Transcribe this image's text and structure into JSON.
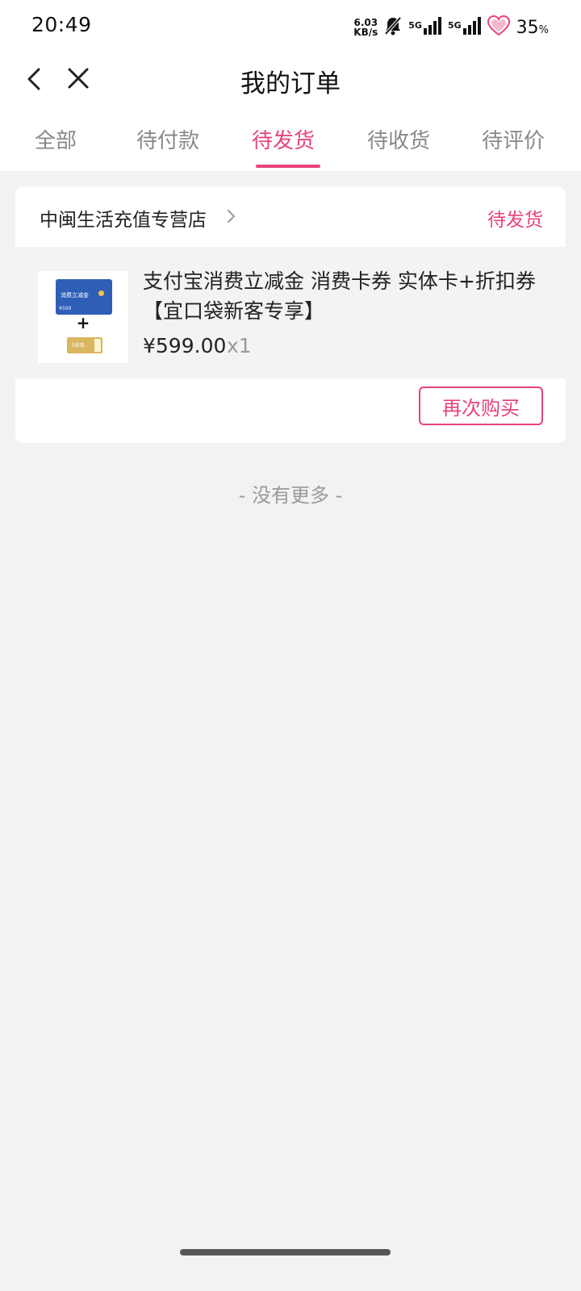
{
  "status_bar": {
    "time": "20:49",
    "net_speed_value": "6.03",
    "net_speed_unit": "KB/s",
    "signal1_label": "5G",
    "signal2_label": "5G",
    "battery_percent": "35",
    "battery_unit": "%"
  },
  "header": {
    "title": "我的订单"
  },
  "tabs": {
    "items": [
      {
        "label": "全部"
      },
      {
        "label": "待付款"
      },
      {
        "label": "待发货"
      },
      {
        "label": "待收货"
      },
      {
        "label": "待评价"
      }
    ],
    "active_index": 2
  },
  "order": {
    "store_name": "中闽生活充值专营店",
    "status": "待发货",
    "item": {
      "title": "支付宝消费立减金 消费卡券 实体卡+折扣券【宜口袋新客专享】",
      "price": "¥599.00",
      "quantity": "x1",
      "thumb_card_text": "消费立减金",
      "thumb_card_value": "¥500",
      "thumb_plus": "+",
      "thumb_voucher_text": "5折券"
    },
    "rebuy_label": "再次购买"
  },
  "footer": {
    "no_more_text": "- 没有更多 -"
  },
  "colors": {
    "accent": "#e94379",
    "background": "#f2f2f2",
    "card": "#ffffff"
  }
}
